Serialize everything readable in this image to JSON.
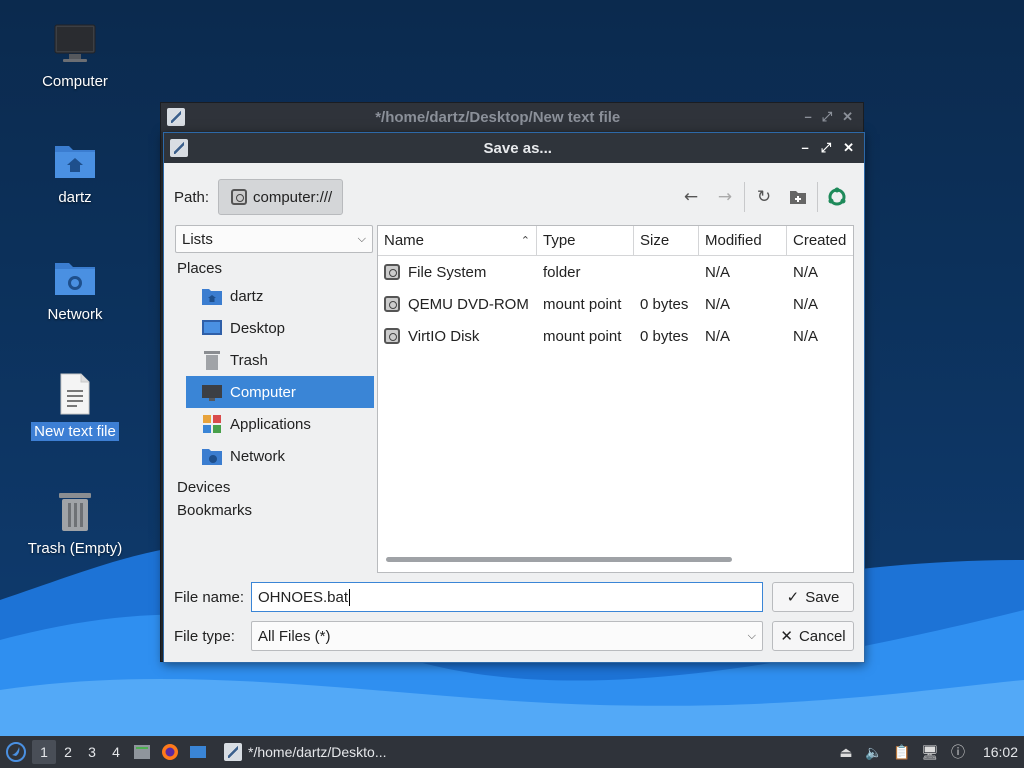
{
  "desktop": {
    "icons": [
      {
        "label": "Computer"
      },
      {
        "label": "dartz"
      },
      {
        "label": "Network"
      },
      {
        "label": "New text file"
      },
      {
        "label": "Trash (Empty)"
      }
    ]
  },
  "bg_window": {
    "title": "*/home/dartz/Desktop/New text file"
  },
  "dialog": {
    "title": "Save as...",
    "path_label": "Path:",
    "path_value": "computer:///",
    "lists_label": "Lists",
    "places_header": "Places",
    "places": [
      {
        "label": "dartz"
      },
      {
        "label": "Desktop"
      },
      {
        "label": "Trash"
      },
      {
        "label": "Computer"
      },
      {
        "label": "Applications"
      },
      {
        "label": "Network"
      }
    ],
    "devices_header": "Devices",
    "bookmarks_header": "Bookmarks",
    "columns": {
      "name": "Name",
      "type": "Type",
      "size": "Size",
      "modified": "Modified",
      "created": "Created"
    },
    "rows": [
      {
        "name": "File System",
        "type": "folder",
        "size": "",
        "modified": "N/A",
        "created": "N/A"
      },
      {
        "name": "QEMU DVD-ROM",
        "type": "mount point",
        "size": "0 bytes",
        "modified": "N/A",
        "created": "N/A"
      },
      {
        "name": "VirtIO Disk",
        "type": "mount point",
        "size": "0 bytes",
        "modified": "N/A",
        "created": "N/A"
      }
    ],
    "filename_label": "File name:",
    "filename_value": "OHNOES.bat",
    "filetype_label": "File type:",
    "filetype_value": "All Files (*)",
    "save_label": "Save",
    "cancel_label": "Cancel"
  },
  "taskbar": {
    "workspaces": [
      "1",
      "2",
      "3",
      "4"
    ],
    "task_label": "*/home/dartz/Deskto...",
    "clock": "16:02"
  },
  "colors": {
    "accent": "#3a85d6",
    "desktop_bg": "#0c2c52",
    "titlebar": "#2f343b"
  }
}
